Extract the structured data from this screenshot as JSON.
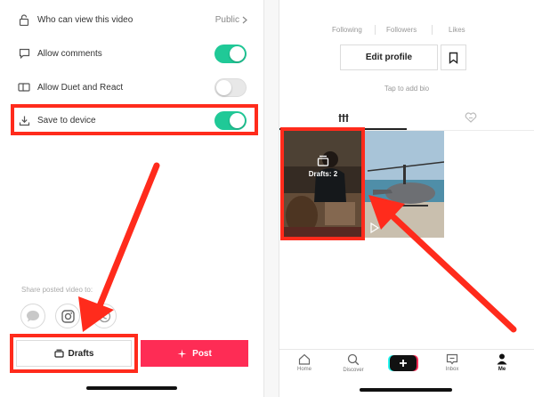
{
  "settings": {
    "rows": [
      {
        "label": "Who can view this video",
        "value": "Public",
        "icon": "lock-icon"
      },
      {
        "label": "Allow comments",
        "toggle": "on",
        "icon": "comment-icon"
      },
      {
        "label": "Allow Duet and React",
        "toggle": "off",
        "icon": "duet-icon"
      },
      {
        "label": "Save to device",
        "toggle": "on",
        "icon": "download-icon"
      }
    ],
    "share_label": "Share posted video to:",
    "share_targets": [
      "message-icon",
      "instagram-icon",
      "whatsapp-icon"
    ]
  },
  "actions": {
    "drafts_label": "Drafts",
    "post_label": "Post"
  },
  "profile": {
    "stats": [
      "Following",
      "Followers",
      "Likes"
    ],
    "edit_profile_label": "Edit profile",
    "bio_placeholder": "Tap to add bio",
    "tabs": [
      "grid-icon",
      "liked-icon"
    ],
    "drafts_overlay": "Drafts: 2"
  },
  "bottom_nav": {
    "items": [
      "Home",
      "Discover",
      "",
      "Inbox",
      "Me"
    ],
    "active": "Me"
  },
  "colors": {
    "toggle_on": "#20c997",
    "post_button": "#fe2c55",
    "highlight": "#ff2b1c"
  }
}
